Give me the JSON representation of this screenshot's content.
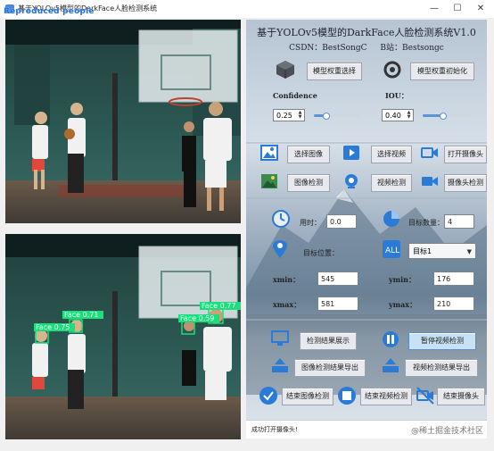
{
  "window": {
    "title": "基于YOLOv5模型的DarkFace人脸检测系统",
    "overlay_text": "Reproduced people",
    "minimize": "—",
    "maximize": "☐",
    "close": "✕"
  },
  "panel": {
    "title": "基于YOLOv5模型的DarkFace人脸检测系统V1.0",
    "csdn": "CSDN：BestSongC",
    "bilibili": "B站：Bestsongc",
    "select_model": "模型权重选择",
    "init_model": "模型权重初始化",
    "confidence_label": "Confidence",
    "confidence_value": "0.25",
    "confidence_fraction": 0.25,
    "iou_label": "IOU：",
    "iou_value": "0.40",
    "iou_fraction": 0.4,
    "select_image": "选择图像",
    "select_video": "选择视频",
    "open_camera": "打开摄像头",
    "image_detect": "图像检测",
    "video_detect": "视频检测",
    "camera_detect": "摄像头检测",
    "time_label": "用时：",
    "time_value": "0.0",
    "count_label": "目标数量：",
    "count_value": "4",
    "position_label": "目标位置：",
    "target_select": "目标1",
    "xmin_label": "xmin：",
    "xmin_value": "545",
    "ymin_label": "ymin：",
    "ymin_value": "176",
    "xmax_label": "xmax：",
    "xmax_value": "581",
    "ymax_label": "ymax：",
    "ymax_value": "210",
    "show_results": "检测结果展示",
    "pause_video": "暂停视频检测",
    "export_image": "图像检测结果导出",
    "export_video": "视频检测结果导出",
    "end_image": "结束图像检测",
    "end_video": "结束视频检测",
    "end_camera": "结束摄像头"
  },
  "detections": [
    {
      "label": "Face 0.75"
    },
    {
      "label": "Face 0.71"
    },
    {
      "label": "Face 0.59"
    },
    {
      "label": "Face 0.77"
    }
  ],
  "status": {
    "message": "成功打开摄像头!",
    "watermark": "@稀土掘金技术社区"
  },
  "colors": {
    "accent": "#2b7bd6",
    "detection_box": "#19e07a"
  }
}
